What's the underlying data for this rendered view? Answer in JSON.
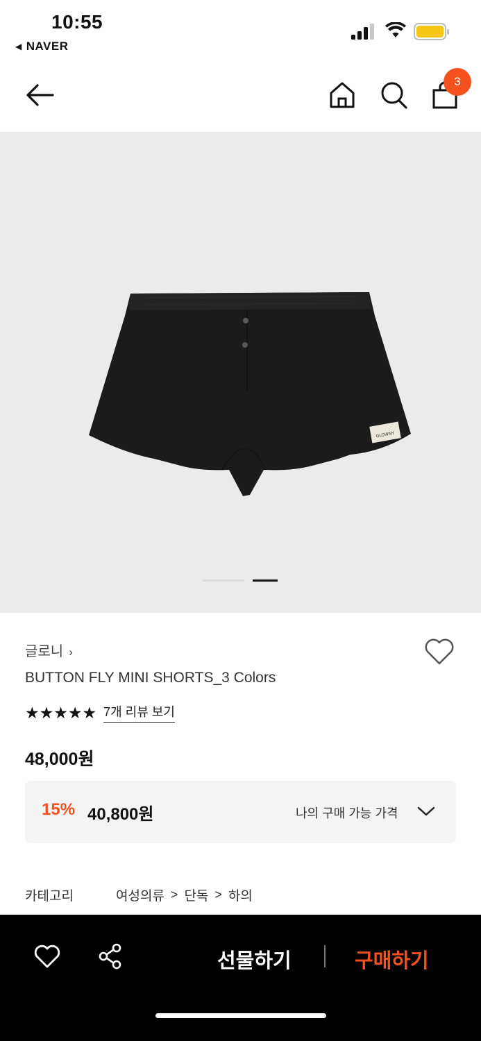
{
  "status_bar": {
    "time": "10:55",
    "back_app": "NAVER",
    "battery_color": "#f5c518"
  },
  "nav": {
    "cart_count": "3",
    "accent": "#f4511e"
  },
  "product": {
    "brand": "글로니",
    "name": "BUTTON FLY MINI SHORTS_3 Colors",
    "stars": "★★★★★",
    "review_link": "7개 리뷰 보기",
    "price": "48,000원",
    "discount": "15%",
    "sale_price": "40,800원",
    "my_price_label": "나의 구매 가능 가격",
    "label_text": "GLOWNY",
    "image_count": 2,
    "image_index": 2
  },
  "category": {
    "label": "카테고리",
    "path": [
      "여성의류",
      "단독",
      "하의"
    ]
  },
  "bottom_bar": {
    "gift": "선물하기",
    "buy": "구매하기"
  }
}
